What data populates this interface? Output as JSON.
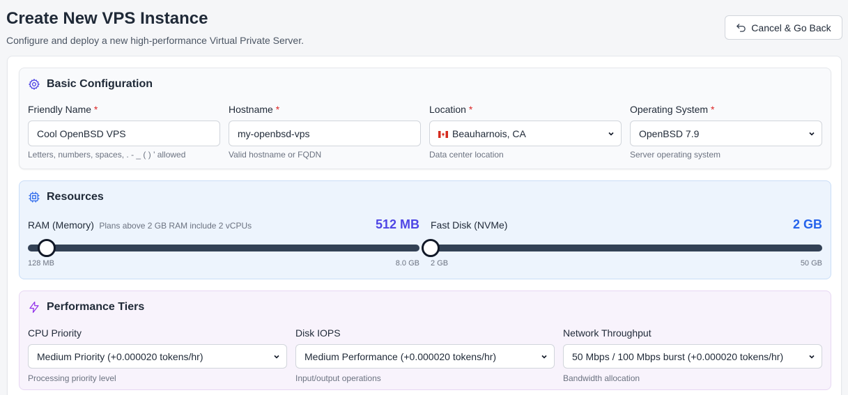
{
  "header": {
    "title": "Create New VPS Instance",
    "subtitle": "Configure and deploy a new high-performance Virtual Private Server.",
    "cancel_label": "Cancel & Go Back"
  },
  "basic": {
    "title": "Basic Configuration",
    "friendly_name": {
      "label": "Friendly Name",
      "required": "*",
      "value": "Cool OpenBSD VPS",
      "helper": "Letters, numbers, spaces, . - _ ( ) ' allowed"
    },
    "hostname": {
      "label": "Hostname",
      "required": "*",
      "value": "my-openbsd-vps",
      "helper": "Valid hostname or FQDN"
    },
    "location": {
      "label": "Location",
      "required": "*",
      "value": "Beauharnois, CA",
      "flag": "canada-flag",
      "helper": "Data center location"
    },
    "os": {
      "label": "Operating System",
      "required": "*",
      "value": "OpenBSD 7.9",
      "helper": "Server operating system"
    }
  },
  "resources": {
    "title": "Resources",
    "ram": {
      "label": "RAM (Memory)",
      "note": "Plans above 2 GB RAM include 2 vCPUs",
      "value_label": "512 MB",
      "value_mb": 512,
      "min_label": "128 MB",
      "max_label": "8.0 GB",
      "min_mb": 128,
      "max_mb": 8192,
      "color": "#4f46e5"
    },
    "disk": {
      "label": "Fast Disk (NVMe)",
      "value_label": "2 GB",
      "value_gb": 2,
      "min_label": "2 GB",
      "max_label": "50 GB",
      "min_gb": 2,
      "max_gb": 50,
      "color": "#2563eb"
    }
  },
  "performance": {
    "title": "Performance Tiers",
    "cpu": {
      "label": "CPU Priority",
      "value": "Medium Priority (+0.000020 tokens/hr)",
      "helper": "Processing priority level"
    },
    "iops": {
      "label": "Disk IOPS",
      "value": "Medium Performance (+0.000020 tokens/hr)",
      "helper": "Input/output operations"
    },
    "network": {
      "label": "Network Throughput",
      "value": "50 Mbps / 100 Mbps burst (+0.000020 tokens/hr)",
      "helper": "Bandwidth allocation"
    }
  },
  "icons": {
    "cancel": "undo-arrow-icon",
    "basic": "gear-icon",
    "resources": "cpu-chip-icon",
    "performance": "lightning-bolt-icon"
  },
  "colors": {
    "accent_purple": "#4f46e5",
    "accent_blue": "#2563eb",
    "required": "#dc2626",
    "slider_track": "#334155"
  }
}
